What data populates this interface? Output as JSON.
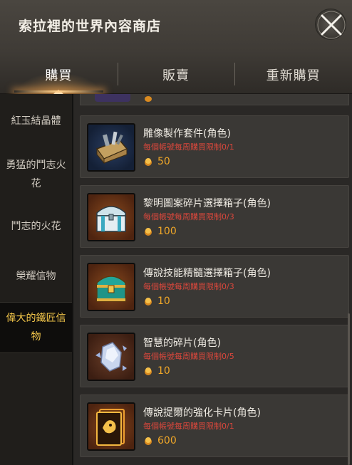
{
  "window": {
    "title": "索拉裡的世界內容商店"
  },
  "tabs": [
    {
      "label": "購買",
      "active": true
    },
    {
      "label": "販賣",
      "active": false
    },
    {
      "label": "重新購買",
      "active": false
    }
  ],
  "sidebar": {
    "items": [
      {
        "label": "紅玉結晶體",
        "active": false
      },
      {
        "label": "勇猛的鬥志火花",
        "active": false
      },
      {
        "label": "鬥志的火花",
        "active": false
      },
      {
        "label": "榮耀信物",
        "active": false
      },
      {
        "label": "偉大的鐵匠信物",
        "active": true
      }
    ]
  },
  "products": [
    {
      "name": "雕像製作套件(角色)",
      "limit": "每個帳號每周購買限制0/1",
      "price": "50",
      "icon": "toolbox-icon"
    },
    {
      "name": "黎明圖案碎片選擇箱子(角色)",
      "limit": "每個帳號每周購買限制0/3",
      "price": "100",
      "icon": "silver-chest-icon"
    },
    {
      "name": "傳說技能精髓選擇箱子(角色)",
      "limit": "每個帳號每周購買限制0/3",
      "price": "10",
      "icon": "teal-chest-icon"
    },
    {
      "name": "智慧的碎片(角色)",
      "limit": "每個帳號每周購買限制0/5",
      "price": "10",
      "icon": "crystal-shard-icon"
    },
    {
      "name": "傳說提爾的強化卡片(角色)",
      "limit": "每個帳號每周購買限制0/1",
      "price": "600",
      "icon": "gold-card-icon"
    }
  ],
  "colors": {
    "accent_gold": "#f3c64a",
    "limit_red": "#d9473c",
    "price_orange": "#f0a728"
  }
}
